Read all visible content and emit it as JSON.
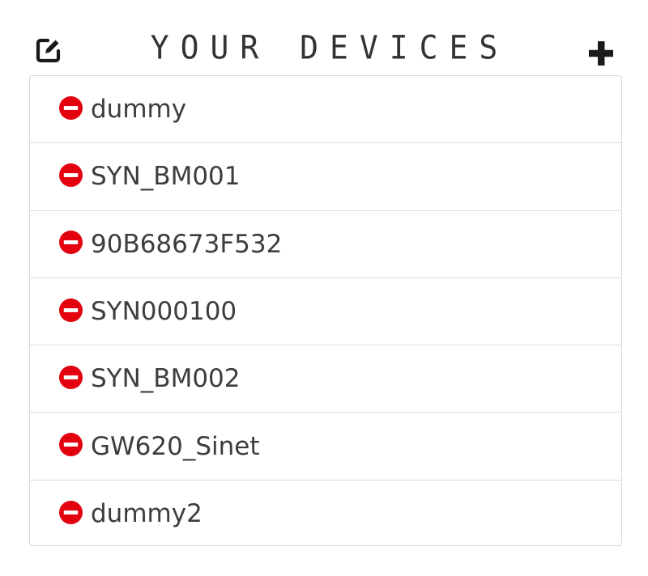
{
  "header": {
    "title": "YOUR DEVICES",
    "edit_icon": "edit-icon",
    "add_icon": "plus-icon"
  },
  "devices": [
    {
      "name": "dummy"
    },
    {
      "name": "SYN_BM001"
    },
    {
      "name": "90B68673F532"
    },
    {
      "name": "SYN000100"
    },
    {
      "name": "SYN_BM002"
    },
    {
      "name": "GW620_Sinet"
    },
    {
      "name": "dummy2"
    }
  ],
  "colors": {
    "remove": "#e3000f",
    "text": "#3d3d3d",
    "border": "#d9d9d9",
    "icon": "#1a1a1a"
  }
}
